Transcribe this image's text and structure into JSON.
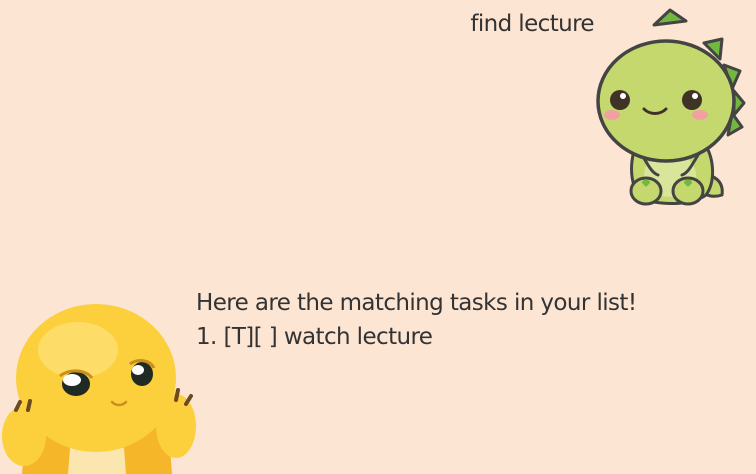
{
  "window": {
    "background_color": "#fde5d3"
  },
  "user_dialog": {
    "text": "find lecture",
    "avatar_icon": "green-dinosaur-icon",
    "avatar_color": "#c5d86d"
  },
  "bot_dialog": {
    "text": "Here are the matching tasks in your list!\n1. [T][ ] watch lecture",
    "avatar_icon": "yellow-creature-icon",
    "avatar_color": "#fbd03c"
  }
}
